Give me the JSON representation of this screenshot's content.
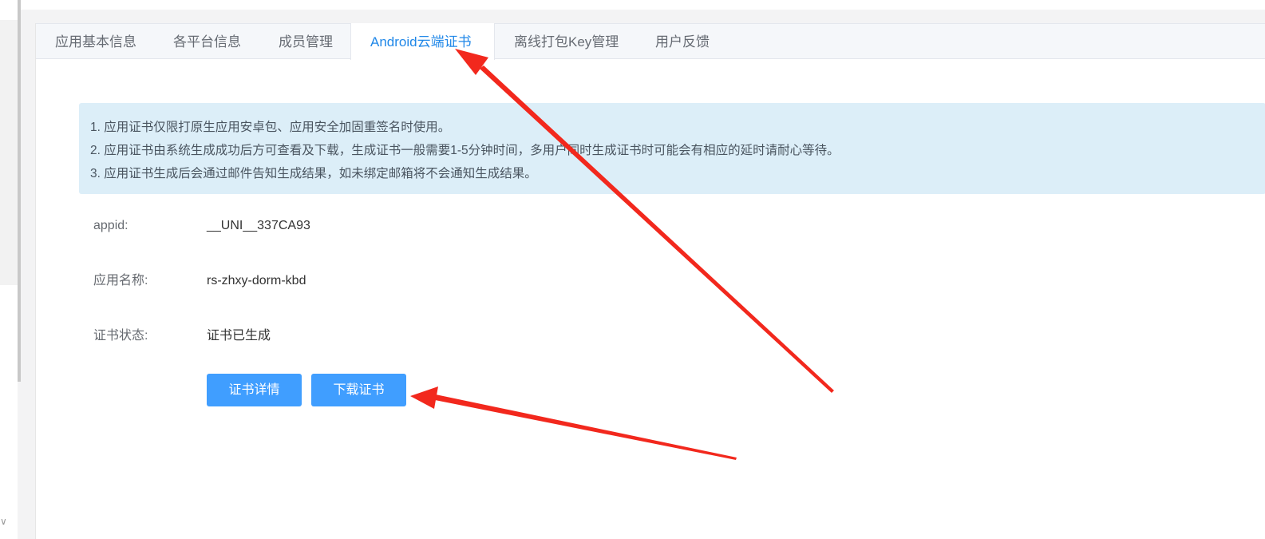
{
  "tabs": [
    {
      "label": "应用基本信息",
      "active": false
    },
    {
      "label": "各平台信息",
      "active": false
    },
    {
      "label": "成员管理",
      "active": false
    },
    {
      "label": "Android云端证书",
      "active": true
    },
    {
      "label": "离线打包Key管理",
      "active": false
    },
    {
      "label": "用户反馈",
      "active": false
    }
  ],
  "notice": {
    "lines": [
      "1. 应用证书仅限打原生应用安卓包、应用安全加固重签名时使用。",
      "2. 应用证书由系统生成成功后方可查看及下载，生成证书一般需要1-5分钟时间，多用户同时生成证书时可能会有相应的延时请耐心等待。",
      "3. 应用证书生成后会通过邮件告知生成结果，如未绑定邮箱将不会通知生成结果。"
    ]
  },
  "info": {
    "appid_label": "appid:",
    "appid_value": "__UNI__337CA93",
    "name_label": "应用名称:",
    "name_value": "rs-zhxy-dorm-kbd",
    "status_label": "证书状态:",
    "status_value": "证书已生成"
  },
  "buttons": {
    "detail_label": "证书详情",
    "download_label": "下载证书"
  },
  "colors": {
    "accent": "#409eff",
    "active_tab": "#1f87e8",
    "notice_bg": "#dceef8",
    "annotation_arrow": "#f2281d"
  }
}
